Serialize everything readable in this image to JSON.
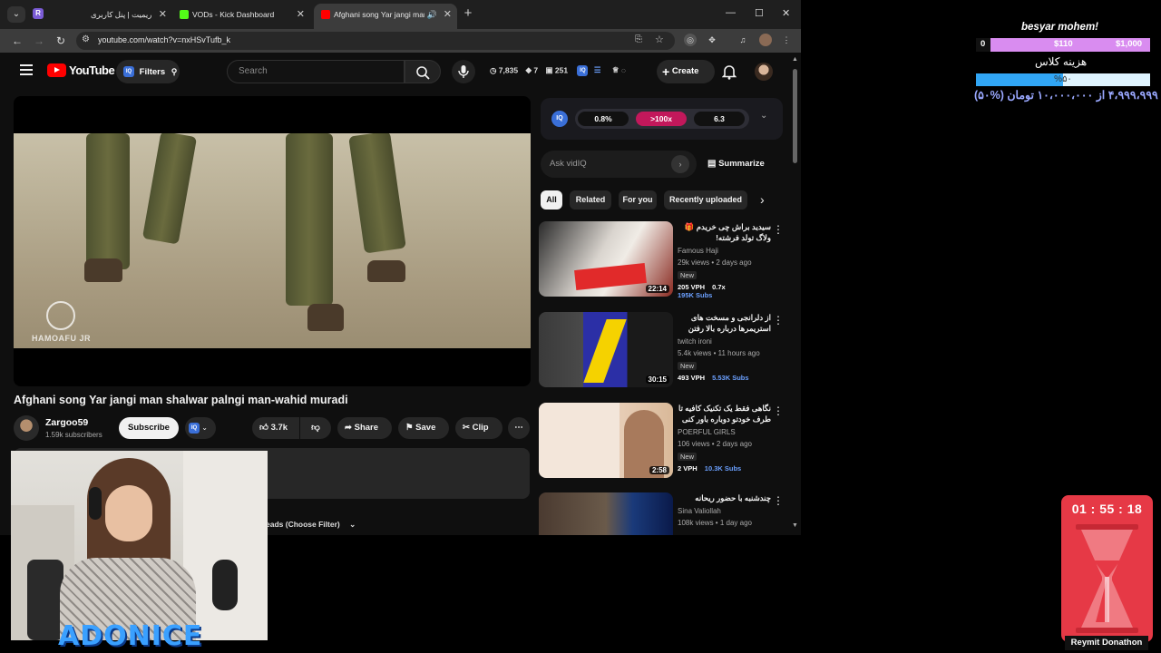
{
  "browser": {
    "tabs": [
      {
        "title": "ریمیت | پنل کاربری",
        "close": "✕"
      },
      {
        "title": "VODs - Kick Dashboard",
        "close": "✕"
      },
      {
        "title": "Afghani song Yar jangi man",
        "close": "✕"
      }
    ],
    "new_tab": "+",
    "window_controls": [
      "—",
      "☐",
      "✕"
    ],
    "url": "youtube.com/watch?v=nxHSvTufb_k"
  },
  "youtube": {
    "logo_text": "YouTube",
    "filters_label": "Filters",
    "search_placeholder": "Search",
    "stats": {
      "views": "7,835",
      "likes": "7",
      "comments": "251"
    },
    "create_label": "Create"
  },
  "video": {
    "title": "Afghani song Yar jangi man shalwar palngi man-wahid muradi",
    "watermark": "HAMOAFU JR",
    "channel": "Zargoo59",
    "subscribers": "1.59k subscribers",
    "subscribe_label": "Subscribe",
    "likes": "3.7k",
    "share_label": "Share",
    "save_label": "Save",
    "clip_label": "Clip",
    "filter_text": "eads (Choose Filter)"
  },
  "vidiq": {
    "badge": "IQ",
    "scores": [
      "0.8%",
      ">100x",
      "6.3"
    ],
    "ask_placeholder": "Ask vidIQ",
    "summarize_label": "Summarize"
  },
  "chips": [
    "All",
    "Related",
    "For you",
    "Recently uploaded"
  ],
  "recommendations": [
    {
      "title": "سیدید براش چی خریدم 🎁 ولاگ تولد فرشته!",
      "channel": "Famous Haji",
      "meta": "29k views • 2 days ago",
      "new": "New",
      "vph": "205 VPH",
      "ratio": "0.7x",
      "subs": "195K Subs",
      "duration": "22:14"
    },
    {
      "title": "از دلرانجی و مسخت های استریمرها درباره بالا رفتن قیمت",
      "channel": "twitch ironi",
      "meta": "5.4k views • 11 hours ago",
      "new": "New",
      "vph": "493 VPH",
      "ratio": "",
      "subs": "5.53K Subs",
      "duration": "30:15"
    },
    {
      "title": "نگاهی فقط یک تکنیک کافیه تا طرف خودتو دوباره باور کنی و با دل",
      "channel": "POERFUL GIRLS",
      "meta": "106 views • 2 days ago",
      "new": "New",
      "vph": "2 VPH",
      "ratio": "",
      "subs": "10.3K Subs",
      "duration": "2:58"
    },
    {
      "title": "چندشنبه با حضور ریحانه پارسا",
      "channel": "Sina Valiollah",
      "meta": "108k views • 1 day ago",
      "new": "",
      "vph": "",
      "ratio": "",
      "subs": "",
      "duration": ""
    }
  ],
  "overlay": {
    "brand": "ADONICE",
    "donation": {
      "title": "besyar mohem!",
      "milestones": [
        "0",
        "$110",
        "$1,000"
      ],
      "goal_label": "هزینه کلاس",
      "progress_text": "%۵۰",
      "amount_text": "۴،۹۹۹،۹۹۹ از ۱۰،۰۰۰،۰۰۰ تومان (%۵۰)",
      "progress_fraction": 0.5
    },
    "timer": {
      "digits": "01 : 55 : 18",
      "label": "Reymit Donathon"
    }
  },
  "colors": {
    "yt_red": "#ff0000",
    "vidiq_blue": "#3a6fd8",
    "highlight_pink": "#c2185b",
    "progress_blue": "#31a6f5",
    "donation_purple": "#d98cf0",
    "timer_red": "#e63946"
  }
}
